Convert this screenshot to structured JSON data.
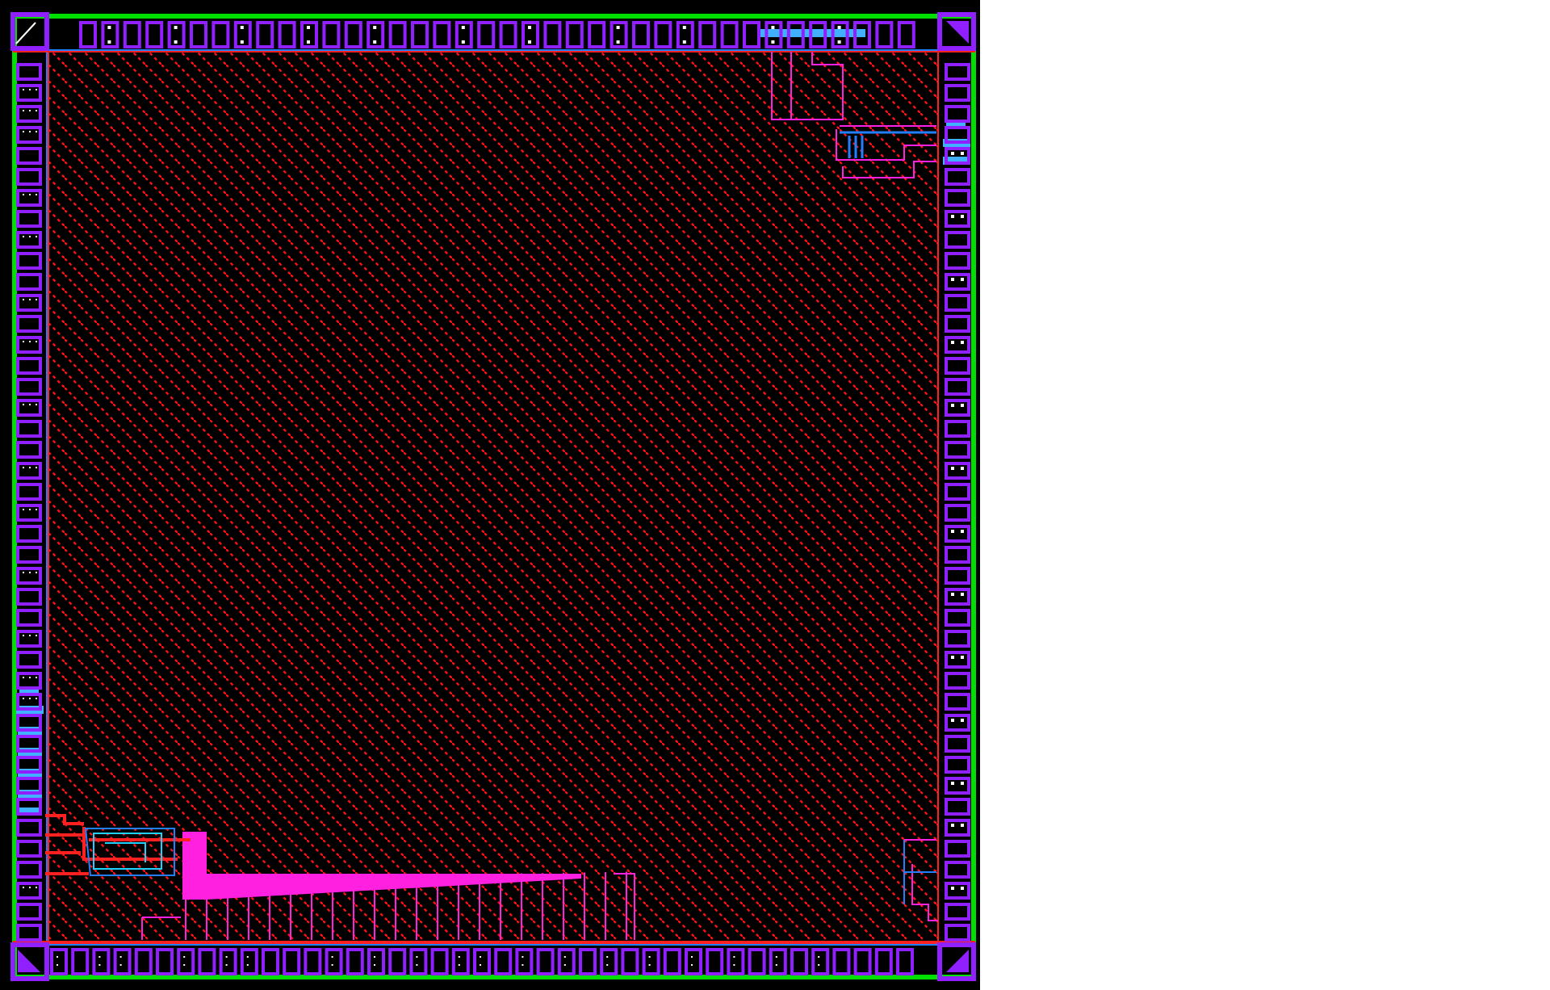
{
  "layout": {
    "top_pads": [
      {
        "marked": false
      },
      {
        "marked": true
      },
      {
        "marked": false
      },
      {
        "marked": false
      },
      {
        "marked": true
      },
      {
        "marked": false
      },
      {
        "marked": false
      },
      {
        "marked": true
      },
      {
        "marked": false
      },
      {
        "marked": false
      },
      {
        "marked": true
      },
      {
        "marked": false
      },
      {
        "marked": false
      },
      {
        "marked": true
      },
      {
        "marked": false
      },
      {
        "marked": false
      },
      {
        "marked": false
      },
      {
        "marked": true
      },
      {
        "marked": false
      },
      {
        "marked": false
      },
      {
        "marked": true
      },
      {
        "marked": false
      },
      {
        "marked": false
      },
      {
        "marked": false
      },
      {
        "marked": true
      },
      {
        "marked": false
      },
      {
        "marked": false
      },
      {
        "marked": true
      },
      {
        "marked": false
      },
      {
        "marked": false
      },
      {
        "marked": false
      },
      {
        "marked": true
      },
      {
        "marked": false
      },
      {
        "marked": false
      },
      {
        "marked": true
      },
      {
        "marked": false
      },
      {
        "marked": false
      },
      {
        "marked": false
      }
    ],
    "left_pads": [
      {
        "marked": false
      },
      {
        "marked": true
      },
      {
        "marked": true
      },
      {
        "marked": true
      },
      {
        "marked": false
      },
      {
        "marked": false
      },
      {
        "marked": true
      },
      {
        "marked": false
      },
      {
        "marked": true
      },
      {
        "marked": false
      },
      {
        "marked": false
      },
      {
        "marked": true
      },
      {
        "marked": false
      },
      {
        "marked": true
      },
      {
        "marked": false
      },
      {
        "marked": false
      },
      {
        "marked": true
      },
      {
        "marked": false
      },
      {
        "marked": false
      },
      {
        "marked": true
      },
      {
        "marked": false
      },
      {
        "marked": true
      },
      {
        "marked": false
      },
      {
        "marked": false
      },
      {
        "marked": true
      },
      {
        "marked": false
      },
      {
        "marked": false
      },
      {
        "marked": true
      },
      {
        "marked": false
      },
      {
        "marked": true
      },
      {
        "marked": true
      },
      {
        "marked": false
      },
      {
        "marked": false
      },
      {
        "marked": false
      },
      {
        "marked": false
      },
      {
        "marked": false
      },
      {
        "marked": false
      },
      {
        "marked": false
      },
      {
        "marked": false
      },
      {
        "marked": true
      },
      {
        "marked": false
      },
      {
        "marked": false
      }
    ],
    "right_pads": [
      {
        "marked": false
      },
      {
        "marked": false
      },
      {
        "marked": false
      },
      {
        "marked": false
      },
      {
        "marked": true
      },
      {
        "marked": false
      },
      {
        "marked": false
      },
      {
        "marked": true
      },
      {
        "marked": false
      },
      {
        "marked": false
      },
      {
        "marked": true
      },
      {
        "marked": false
      },
      {
        "marked": false
      },
      {
        "marked": true
      },
      {
        "marked": false
      },
      {
        "marked": false
      },
      {
        "marked": true
      },
      {
        "marked": false
      },
      {
        "marked": false
      },
      {
        "marked": true
      },
      {
        "marked": false
      },
      {
        "marked": false
      },
      {
        "marked": true
      },
      {
        "marked": false
      },
      {
        "marked": false
      },
      {
        "marked": true
      },
      {
        "marked": false
      },
      {
        "marked": false
      },
      {
        "marked": true
      },
      {
        "marked": false
      },
      {
        "marked": false
      },
      {
        "marked": true
      },
      {
        "marked": false
      },
      {
        "marked": false
      },
      {
        "marked": true
      },
      {
        "marked": false
      },
      {
        "marked": true
      },
      {
        "marked": false
      },
      {
        "marked": false
      },
      {
        "marked": true
      },
      {
        "marked": false
      },
      {
        "marked": false
      }
    ],
    "bottom_pads": [
      {
        "marked": true
      },
      {
        "marked": false
      },
      {
        "marked": true
      },
      {
        "marked": true
      },
      {
        "marked": false
      },
      {
        "marked": false
      },
      {
        "marked": true
      },
      {
        "marked": false
      },
      {
        "marked": true
      },
      {
        "marked": true
      },
      {
        "marked": false
      },
      {
        "marked": false
      },
      {
        "marked": false
      },
      {
        "marked": true
      },
      {
        "marked": false
      },
      {
        "marked": true
      },
      {
        "marked": false
      },
      {
        "marked": true
      },
      {
        "marked": false
      },
      {
        "marked": true
      },
      {
        "marked": true
      },
      {
        "marked": false
      },
      {
        "marked": true
      },
      {
        "marked": false
      },
      {
        "marked": true
      },
      {
        "marked": false
      },
      {
        "marked": true
      },
      {
        "marked": false
      },
      {
        "marked": true
      },
      {
        "marked": false
      },
      {
        "marked": true
      },
      {
        "marked": false
      },
      {
        "marked": true
      },
      {
        "marked": false
      },
      {
        "marked": true
      },
      {
        "marked": false
      },
      {
        "marked": true
      },
      {
        "marked": false
      },
      {
        "marked": false
      },
      {
        "marked": false
      },
      {
        "marked": false
      }
    ]
  }
}
